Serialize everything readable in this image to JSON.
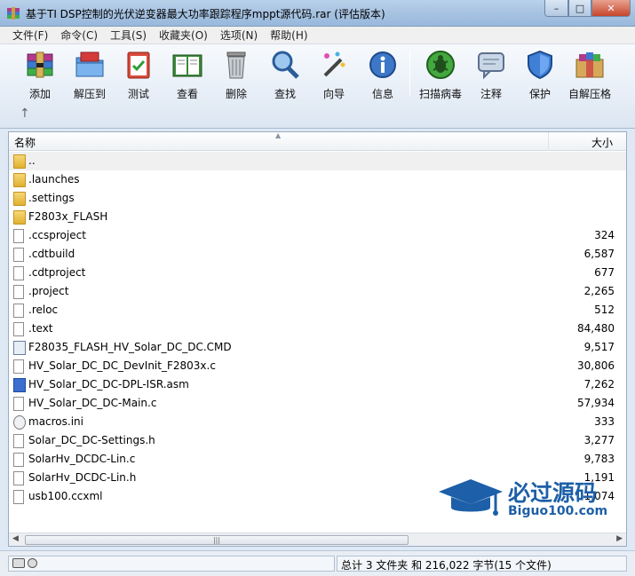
{
  "window": {
    "title": "基于TI DSP控制的光伏逆变器最大功率跟踪程序mppt源代码.rar (评估版本)",
    "min_glyph": "–",
    "max_glyph": "□",
    "close_glyph": "✕"
  },
  "menu": [
    "文件(F)",
    "命令(C)",
    "工具(S)",
    "收藏夹(O)",
    "选项(N)",
    "帮助(H)"
  ],
  "toolbar": {
    "add": "添加",
    "extract": "解压到",
    "test": "测试",
    "view": "查看",
    "delete": "删除",
    "find": "查找",
    "wizard": "向导",
    "info": "信息",
    "scan": "扫描病毒",
    "comment": "注释",
    "protect": "保护",
    "sfx": "自解压格",
    "up_glyph": "↑"
  },
  "list": {
    "col_name": "名称",
    "col_size": "大小",
    "sort_glyph": "▲",
    "files": [
      {
        "name": "..",
        "size": "",
        "type": "parent"
      },
      {
        "name": ".launches",
        "size": "",
        "type": "folder"
      },
      {
        "name": ".settings",
        "size": "",
        "type": "folder"
      },
      {
        "name": "F2803x_FLASH",
        "size": "",
        "type": "folder"
      },
      {
        "name": ".ccsproject",
        "size": "324",
        "type": "file"
      },
      {
        "name": ".cdtbuild",
        "size": "6,587",
        "type": "file"
      },
      {
        "name": ".cdtproject",
        "size": "677",
        "type": "file"
      },
      {
        "name": ".project",
        "size": "2,265",
        "type": "file"
      },
      {
        "name": ".reloc",
        "size": "512",
        "type": "file"
      },
      {
        "name": ".text",
        "size": "84,480",
        "type": "file"
      },
      {
        "name": "F28035_FLASH_HV_Solar_DC_DC.CMD",
        "size": "9,517",
        "type": "cmd"
      },
      {
        "name": "HV_Solar_DC_DC_DevInit_F2803x.c",
        "size": "30,806",
        "type": "file"
      },
      {
        "name": "HV_Solar_DC_DC-DPL-ISR.asm",
        "size": "7,262",
        "type": "asm"
      },
      {
        "name": "HV_Solar_DC_DC-Main.c",
        "size": "57,934",
        "type": "file"
      },
      {
        "name": "macros.ini",
        "size": "333",
        "type": "ini"
      },
      {
        "name": "Solar_DC_DC-Settings.h",
        "size": "3,277",
        "type": "file"
      },
      {
        "name": "SolarHv_DCDC-Lin.c",
        "size": "9,783",
        "type": "file"
      },
      {
        "name": "SolarHv_DCDC-Lin.h",
        "size": "1,191",
        "type": "file"
      },
      {
        "name": "usb100.ccxml",
        "size": "1,074",
        "type": "file"
      }
    ],
    "hscroll_grip": "|||",
    "scroll_left": "◀",
    "scroll_right": "▶"
  },
  "watermark": {
    "title": "必过源码",
    "site": "Biguo100.com"
  },
  "status": {
    "summary": "总计 3 文件夹 和 216,022 字节(15 个文件)"
  }
}
